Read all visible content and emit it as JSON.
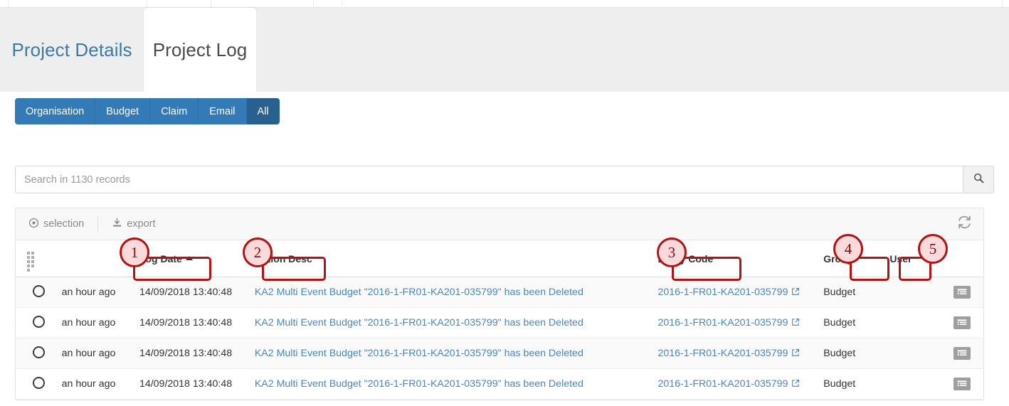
{
  "tabs": {
    "inactive_label": "Project Details",
    "active_label": "Project Log"
  },
  "filter_group": {
    "buttons": [
      {
        "label": "Organisation",
        "active": false
      },
      {
        "label": "Budget",
        "active": false
      },
      {
        "label": "Claim",
        "active": false
      },
      {
        "label": "Email",
        "active": false
      },
      {
        "label": "All",
        "active": true
      }
    ]
  },
  "search": {
    "value": "",
    "placeholder": "Search in 1130 records",
    "button_icon": "search-icon"
  },
  "grid_toolbar": {
    "selection_label": "selection",
    "export_label": "export",
    "selection_icon": "selection-target-icon",
    "export_icon": "download-icon",
    "refresh_icon": "refresh-icon"
  },
  "table": {
    "header_grid_icon": "grid-dots-icon",
    "columns": [
      {
        "key": "select",
        "label": ""
      },
      {
        "key": "ago",
        "label": ""
      },
      {
        "key": "log_date",
        "label": "Log Date",
        "sorted": "asc"
      },
      {
        "key": "action_desc",
        "label": "Action Desc"
      },
      {
        "key": "entity_code",
        "label": "Entity Code"
      },
      {
        "key": "group",
        "label": "Group"
      },
      {
        "key": "user",
        "label": "User"
      },
      {
        "key": "actions",
        "label": ""
      }
    ],
    "rows": [
      {
        "ago": "an hour ago",
        "log_date": "14/09/2018 13:40:48",
        "action_desc": "KA2 Multi Event Budget \"2016-1-FR01-KA201-035799\" has been Deleted",
        "entity_code": "2016-1-FR01-KA201-035799",
        "group": "Budget",
        "user": ""
      },
      {
        "ago": "an hour ago",
        "log_date": "14/09/2018 13:40:48",
        "action_desc": "KA2 Multi Event Budget \"2016-1-FR01-KA201-035799\" has been Deleted",
        "entity_code": "2016-1-FR01-KA201-035799",
        "group": "Budget",
        "user": ""
      },
      {
        "ago": "an hour ago",
        "log_date": "14/09/2018 13:40:48",
        "action_desc": "KA2 Multi Event Budget \"2016-1-FR01-KA201-035799\" has been Deleted",
        "entity_code": "2016-1-FR01-KA201-035799",
        "group": "Budget",
        "user": ""
      },
      {
        "ago": "an hour ago",
        "log_date": "14/09/2018 13:40:48",
        "action_desc": "KA2 Multi Event Budget \"2016-1-FR01-KA201-035799\" has been Deleted",
        "entity_code": "2016-1-FR01-KA201-035799",
        "group": "Budget",
        "user": ""
      }
    ]
  },
  "annotations": [
    {
      "number": "1",
      "target": "Log Date"
    },
    {
      "number": "2",
      "target": "Action Desc"
    },
    {
      "number": "3",
      "target": "Entity Code"
    },
    {
      "number": "4",
      "target": "Group"
    },
    {
      "number": "5",
      "target": "User"
    }
  ],
  "colors": {
    "primary_blue": "#337ab7",
    "active_blue": "#286090",
    "link_blue": "#4a86b8",
    "tab_blue": "#3c7ba5",
    "annotation_red": "#b31313",
    "annotation_fill": "#fadadb"
  }
}
